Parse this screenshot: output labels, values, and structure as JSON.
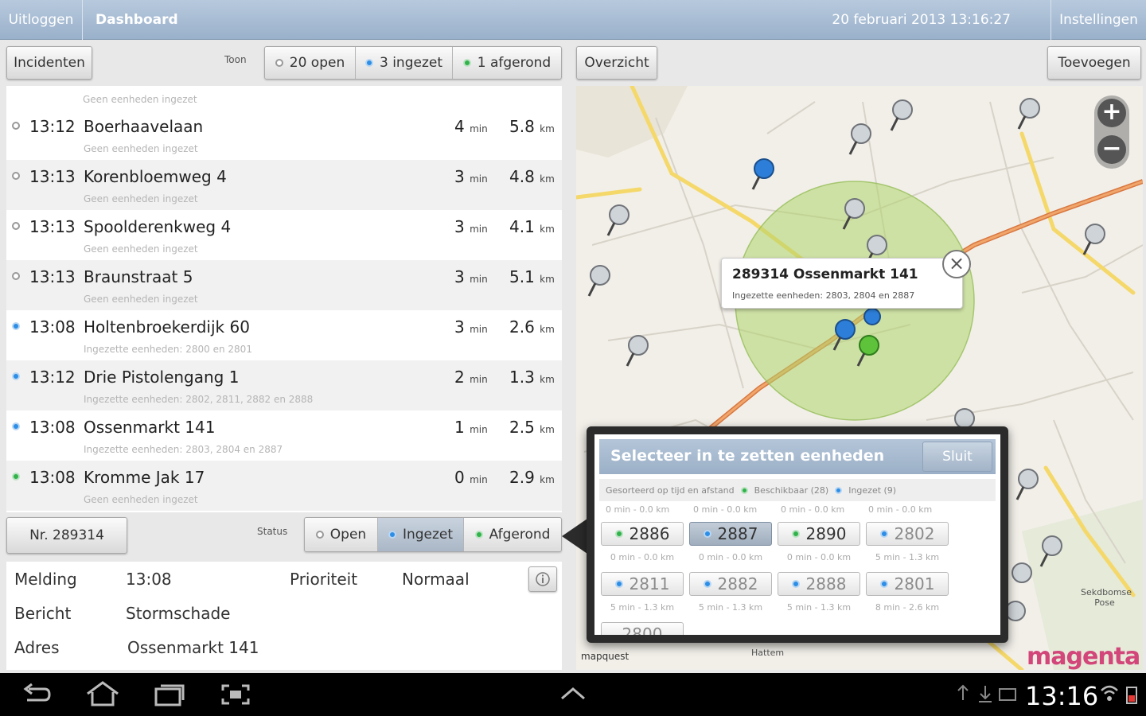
{
  "topbar": {
    "logout": "Uitloggen",
    "dashboard": "Dashboard",
    "datetime": "20 februari 2013   13:16:27",
    "settings": "Instellingen"
  },
  "left_toolbar": {
    "incidents_button": "Incidenten",
    "show_label": "Toon",
    "filters": [
      {
        "label": "20 open",
        "status": "grey"
      },
      {
        "label": "3 ingezet",
        "status": "blue"
      },
      {
        "label": "1 afgerond",
        "status": "green"
      }
    ]
  },
  "list_top_partial_sub": "Geen eenheden ingezet",
  "incidents": [
    {
      "time": "13:12",
      "address": "Boerhaavelaan",
      "min": "4",
      "km": "5.8",
      "units": "Geen eenheden ingezet",
      "status": "grey"
    },
    {
      "time": "13:13",
      "address": "Korenbloemweg 4",
      "min": "3",
      "km": "4.8",
      "units": "Geen eenheden ingezet",
      "status": "grey"
    },
    {
      "time": "13:13",
      "address": "Spoolderenkweg 4",
      "min": "3",
      "km": "4.1",
      "units": "Geen eenheden ingezet",
      "status": "grey"
    },
    {
      "time": "13:13",
      "address": "Braunstraat 5",
      "min": "3",
      "km": "5.1",
      "units": "Geen eenheden ingezet",
      "status": "grey"
    },
    {
      "time": "13:08",
      "address": "Holtenbroekerdijk 60",
      "min": "3",
      "km": "2.6",
      "units": "Ingezette eenheden: 2800 en 2801",
      "status": "blue"
    },
    {
      "time": "13:12",
      "address": "Drie Pistolengang 1",
      "min": "2",
      "km": "1.3",
      "units": "Ingezette eenheden: 2802, 2811, 2882 en 2888",
      "status": "blue"
    },
    {
      "time": "13:08",
      "address": "Ossenmarkt 141",
      "min": "1",
      "km": "2.5",
      "units": "Ingezette eenheden: 2803, 2804 en 2887",
      "status": "blue"
    },
    {
      "time": "13:08",
      "address": "Kromme Jak 17",
      "min": "0",
      "km": "2.9",
      "units": "Geen eenheden ingezet",
      "status": "green"
    }
  ],
  "units_min": "min",
  "units_km": "km",
  "detail_bar": {
    "number_button": "Nr. 289314",
    "status_label": "Status",
    "statuses": [
      {
        "label": "Open",
        "status": "grey",
        "active": false
      },
      {
        "label": "Ingezet",
        "status": "blue",
        "active": true
      },
      {
        "label": "Afgerond",
        "status": "green",
        "active": false
      }
    ]
  },
  "detail": {
    "melding_label": "Melding",
    "melding_value": "13:08",
    "prioriteit_label": "Prioriteit",
    "prioriteit_value": "Normaal",
    "bericht_label": "Bericht",
    "bericht_value": "Stormschade",
    "adres_label": "Adres",
    "adres_value": "Ossenmarkt 141"
  },
  "right_toolbar": {
    "overview_button": "Overzicht",
    "add_button": "Toevoegen"
  },
  "map": {
    "callout_title": "289314 Ossenmarkt 141",
    "callout_sub": "Ingezette eenheden: 2803, 2804 en 2887",
    "credit": "mapquest",
    "logo": "magenta",
    "town_hattem": "Hattem",
    "town_pose": "Sekdbomse Pose"
  },
  "popup": {
    "title": "Selecteer in te zetten eenheden",
    "close": "Sluit",
    "legend_sort": "Gesorteerd op tijd en afstand",
    "legend_available": "Beschikbaar (28)",
    "legend_deployed": "Ingezet (9)",
    "peek_top": "0 min - 0.0 km",
    "peek_bottom": "2800",
    "units": [
      {
        "id": "2886",
        "status": "green",
        "selected": false,
        "sub": "0 min - 0.0 km"
      },
      {
        "id": "2887",
        "status": "blue",
        "selected": true,
        "sub": "0 min - 0.0 km"
      },
      {
        "id": "2890",
        "status": "green",
        "selected": false,
        "sub": "0 min - 0.0 km"
      },
      {
        "id": "2802",
        "status": "blue",
        "selected": false,
        "sub": "5 min - 1.3 km"
      },
      {
        "id": "2811",
        "status": "blue",
        "selected": false,
        "sub": "5 min - 1.3 km"
      },
      {
        "id": "2882",
        "status": "blue",
        "selected": false,
        "sub": "5 min - 1.3 km"
      },
      {
        "id": "2888",
        "status": "blue",
        "selected": false,
        "sub": "5 min - 1.3 km"
      },
      {
        "id": "2801",
        "status": "blue",
        "selected": false,
        "sub": "8 min - 2.6 km"
      }
    ]
  },
  "navbar": {
    "clock": "13:16"
  }
}
